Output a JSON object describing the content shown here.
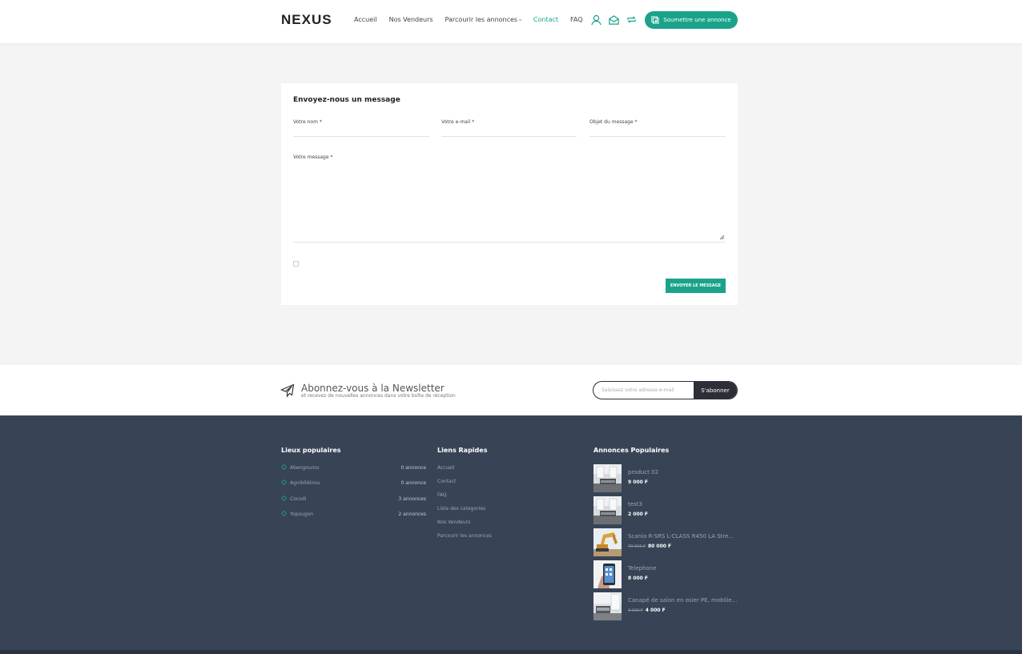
{
  "header": {
    "logo": "NEXUS",
    "nav": [
      {
        "label": "Accueil"
      },
      {
        "label": "Nos Vendeurs"
      },
      {
        "label": "Parcourir les annonces"
      },
      {
        "label": "Contact"
      },
      {
        "label": "FAQ"
      }
    ],
    "browse_chevron": "›",
    "submit_label": "Soumettre une annonce",
    "accent": "#1aa38a"
  },
  "form": {
    "title": "Envoyez-nous un message",
    "name_label": "Votre nom *",
    "email_label": "Votre e-mail *",
    "subject_label": "Objet du message *",
    "message_label": "Votre message *",
    "send_label": "ENVOYER LE MESSAGE"
  },
  "newsletter": {
    "title": "Abonnez-vous à la Newsletter",
    "subtitle": "et recevez de nouvelles annonces dans votre boîte de réception",
    "placeholder": "Saisissez votre adresse e-mail",
    "button": "S'abonner"
  },
  "footer": {
    "places_title": "Lieux populaires",
    "places": [
      {
        "name": "Abengourou",
        "count": "0 annonce"
      },
      {
        "name": "Agnibilékrou",
        "count": "0 annonce"
      },
      {
        "name": "Cocodi",
        "count": "3 annonces"
      },
      {
        "name": "Yopougon",
        "count": "2 annonces"
      }
    ],
    "links_title": "Liens Rapides",
    "links": [
      "Accueil",
      "Contact",
      "FAQ",
      "Liste des categories",
      "Nos Vendeurs",
      "Parcourir les annonces"
    ],
    "popular_title": "Annonces Populaires",
    "products": [
      {
        "name": "product 02",
        "old_price": "",
        "price": "9 000 F",
        "thumb": "room"
      },
      {
        "name": "test3",
        "old_price": "",
        "price": "2 000 F",
        "thumb": "room"
      },
      {
        "name": "Scania R-SRS L-CLASS R450 LA Stre...",
        "old_price": "70 000 F",
        "price": "80 000 F",
        "thumb": "excavator"
      },
      {
        "name": "Telephone",
        "old_price": "",
        "price": "8 000 F",
        "thumb": "phone"
      },
      {
        "name": "Canapé de salon en osier PE, mobilie...",
        "old_price": "3 000 F",
        "price": "4 000 F",
        "thumb": "room"
      }
    ]
  }
}
